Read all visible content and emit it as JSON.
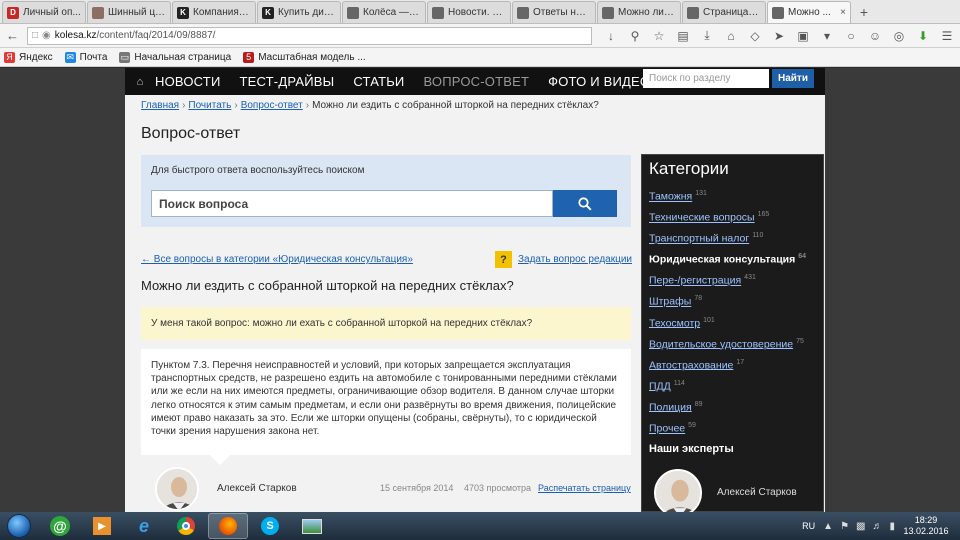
{
  "browser": {
    "tabs": [
      {
        "label": "Личный оп...",
        "color": "#c62828",
        "glyph": "D"
      },
      {
        "label": "Шинный це...",
        "color": "#8d6e63",
        "glyph": ""
      },
      {
        "label": "Компания «...",
        "color": "#222222",
        "glyph": "K"
      },
      {
        "label": "Купить диск...",
        "color": "#222222",
        "glyph": "K"
      },
      {
        "label": "Колёса — о...",
        "color": "#666666",
        "glyph": ""
      },
      {
        "label": "Новости. П...",
        "color": "#666666",
        "glyph": ""
      },
      {
        "label": "Ответы на в...",
        "color": "#666666",
        "glyph": ""
      },
      {
        "label": "Можно ли п...",
        "color": "#666666",
        "glyph": ""
      },
      {
        "label": "Страница 3 |...",
        "color": "#666666",
        "glyph": ""
      },
      {
        "label": "Можно ...",
        "color": "#666666",
        "glyph": ""
      }
    ],
    "url_host": "kolesa.kz",
    "url_path": "/content/faq/2014/09/8887/",
    "bookmarks": [
      {
        "label": "Яндекс",
        "color": "#e53935",
        "glyph": "Я"
      },
      {
        "label": "Почта",
        "color": "#1e88e5",
        "glyph": "✉"
      },
      {
        "label": "Начальная страница",
        "color": "#777777",
        "glyph": "▭"
      },
      {
        "label": "Масштабная модель ...",
        "color": "#b71c1c",
        "glyph": "5"
      }
    ]
  },
  "site": {
    "nav": [
      "НОВОСТИ",
      "ТЕСТ-ДРАЙВЫ",
      "СТАТЬИ",
      "ВОПРОС-ОТВЕТ",
      "ФОТО И ВИДЕО"
    ],
    "search_placeholder": "Поиск по разделу",
    "search_button": "Найти"
  },
  "breadcrumb": [
    "Главная",
    "Почитать",
    "Вопрос-ответ"
  ],
  "breadcrumb_current": "Можно ли ездить с собранной шторкой на передних стёклах?",
  "page_title": "Вопрос-ответ",
  "search": {
    "hint": "Для быстрого ответа воспользуйтесь поиском",
    "placeholder": "Поиск вопроса"
  },
  "back_link": "← Все вопросы в категории «Юридическая консультация»",
  "ask_link": "Задать вопрос редакции",
  "question_title": "Можно ли ездить с собранной шторкой на передних стёклах?",
  "question_text": "У меня такой вопрос: можно ли ехать с собранной шторкой на передних стёклах?",
  "answer_text": "Пунктом 7.3. Перечня неисправностей и условий, при которых запрещается эксплуатация транспортных средств, не разрешено ездить на автомобиле с тонированными передними стёклами или же если на них имеются предметы, ограничивающие обзор водителя. В данном случае шторки легко относятся к этим самым предметам, и если они развёрнуты во время движения, полицейские имеют право наказать за это. Если же шторки опущены (собраны, свёрнуты), то с юридической точки зрения нарушения закона нет.",
  "expert": {
    "name": "Алексей Старков",
    "date": "15 сентября 2014",
    "views": "4703 просмотра",
    "print": "Распечатать страницу"
  },
  "sidebar": {
    "title": "Категории",
    "categories": [
      {
        "name": "Таможня",
        "count": "131",
        "current": false
      },
      {
        "name": "Технические вопросы",
        "count": "165",
        "current": false
      },
      {
        "name": "Транспортный налог",
        "count": "110",
        "current": false
      },
      {
        "name": "Юридическая консультация",
        "count": "64",
        "current": true
      },
      {
        "name": "Пере-/регистрация",
        "count": "431",
        "current": false
      },
      {
        "name": "Штрафы",
        "count": "78",
        "current": false
      },
      {
        "name": "Техосмотр",
        "count": "101",
        "current": false
      },
      {
        "name": "Водительское удостоверение",
        "count": "75",
        "current": false
      },
      {
        "name": "Автострахование",
        "count": "17",
        "current": false
      },
      {
        "name": "ПДД",
        "count": "114",
        "current": false
      },
      {
        "name": "Полиция",
        "count": "89",
        "current": false
      },
      {
        "name": "Прочее",
        "count": "59",
        "current": false
      }
    ],
    "experts_title": "Наши эксперты",
    "expert_name": "Алексей Старков"
  },
  "taskbar": {
    "lang": "RU",
    "time": "18:29",
    "date": "13.02.2016"
  }
}
